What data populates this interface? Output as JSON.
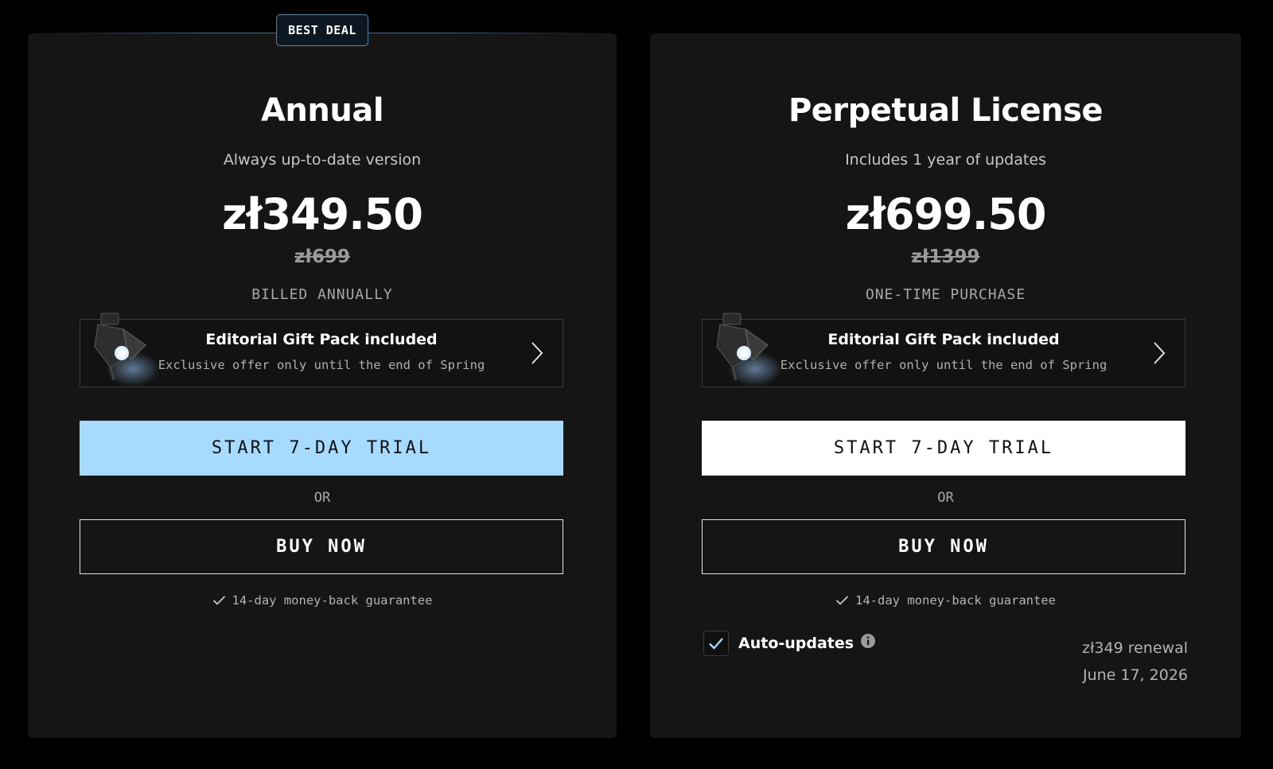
{
  "plans": [
    {
      "badge": "BEST DEAL",
      "title": "Annual",
      "subtitle": "Always up-to-date version",
      "price": "zł349.50",
      "old_price": "zł699",
      "billing": "BILLED ANNUALLY",
      "gift": {
        "title": "Editorial Gift Pack included",
        "subtitle": "Exclusive offer only until the end of Spring",
        "icon": "spotlight-icon"
      },
      "trial_label": "START 7-DAY TRIAL",
      "or_label": "OR",
      "buy_label": "BUY NOW",
      "guarantee": "14-day money-back guarantee"
    },
    {
      "title": "Perpetual License",
      "subtitle": "Includes 1 year of updates",
      "price": "zł699.50",
      "old_price": "zł1399",
      "billing": "ONE-TIME PURCHASE",
      "gift": {
        "title": "Editorial Gift Pack included",
        "subtitle": "Exclusive offer only until the end of Spring",
        "icon": "spotlight-icon"
      },
      "trial_label": "START 7-DAY TRIAL",
      "or_label": "OR",
      "buy_label": "BUY NOW",
      "guarantee": "14-day money-back guarantee",
      "auto_updates": {
        "label": "Auto-updates",
        "checked": true,
        "renewal_price": "zł349 renewal",
        "renewal_date": "June 17, 2026"
      }
    }
  ],
  "colors": {
    "page_bg": "#000000",
    "card_bg": "#151515",
    "accent_blue": "#a6dbff",
    "badge_border": "#5d86a8",
    "muted_text": "#a8a8a8"
  }
}
